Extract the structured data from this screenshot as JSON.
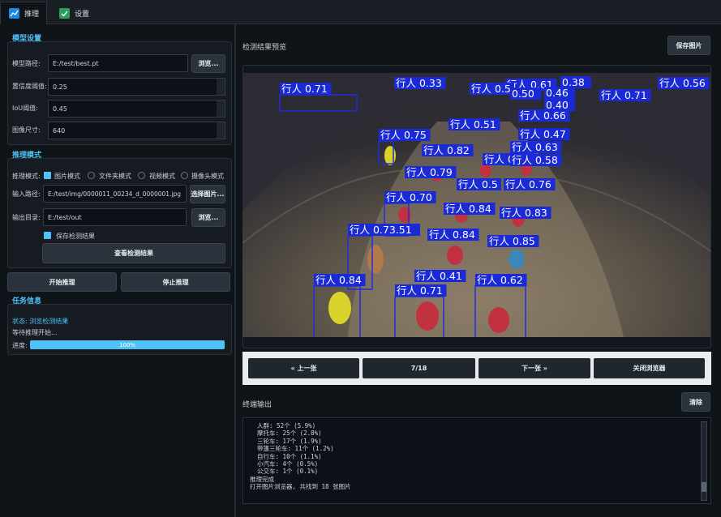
{
  "tabs": [
    {
      "label": "推理",
      "icon": "chart-icon",
      "active": true
    },
    {
      "label": "设置",
      "icon": "check-icon",
      "active": false
    }
  ],
  "model_settings": {
    "title": "模型设置",
    "model_path_label": "模型路径:",
    "model_path": "E:/test/best.pt",
    "browse_label": "浏览...",
    "conf_label": "置信度阈值:",
    "conf": "0.25",
    "iou_label": "IoU阈值:",
    "iou": "0.45",
    "size_label": "图像尺寸:",
    "size": "640"
  },
  "infer_mode": {
    "title": "推理模式",
    "mode_label": "推理模式:",
    "modes": [
      "图片模式",
      "文件夹模式",
      "视频模式",
      "摄像头模式"
    ],
    "selected": "图片模式",
    "input_label": "输入路径:",
    "input_path": "E:/test/img/0000011_00234_d_0000001.jpg",
    "select_image_label": "选择图片...",
    "output_label": "输出目录:",
    "output_path": "E:/test/out",
    "browse_label": "浏览...",
    "save_result_label": "保存检测结果",
    "view_result_label": "查看检测结果"
  },
  "actions": {
    "start": "开始推理",
    "stop": "停止推理"
  },
  "task_info": {
    "title": "任务信息",
    "status": "状态: 浏览检测结果",
    "waiting": "等待推理开始...",
    "progress_label": "进度:",
    "progress_text": "100%",
    "progress_fraction": 1.0
  },
  "preview": {
    "title": "检测结果预览",
    "save_label": "保存图片",
    "detections": [
      {
        "text": "行人 0.71"
      },
      {
        "text": "行人 0.33"
      },
      {
        "text": "行人 0.61"
      },
      {
        "text": "0.38"
      },
      {
        "text": "行人 0.56"
      },
      {
        "text": "行人 0.71"
      },
      {
        "text": "行人 0.5"
      },
      {
        "text": "0.46"
      },
      {
        "text": "0.50"
      },
      {
        "text": "0.40"
      },
      {
        "text": "行人 0.66"
      },
      {
        "text": "行人 0.51"
      },
      {
        "text": "行人 0.75"
      },
      {
        "text": "行人 0.47"
      },
      {
        "text": "行人 0.82"
      },
      {
        "text": "行人 0.63"
      },
      {
        "text": "行人 0.80"
      },
      {
        "text": "行人 0.58"
      },
      {
        "text": "行人 0.79"
      },
      {
        "text": "行人 0.5"
      },
      {
        "text": "行人 0.76"
      },
      {
        "text": "行人 0.70"
      },
      {
        "text": "行人 0.84"
      },
      {
        "text": "行人 0.83"
      },
      {
        "text": "行人 0.73.51"
      },
      {
        "text": "行人 0.84"
      },
      {
        "text": "行人 0.85"
      },
      {
        "text": "行人 0.84"
      },
      {
        "text": "行人 0.41"
      },
      {
        "text": "行人 0.71"
      },
      {
        "text": "行人 0.62"
      }
    ]
  },
  "nav": {
    "prev": "« 上一张",
    "counter": "7/18",
    "next": "下一张 »",
    "close": "关闭浏览器"
  },
  "terminal": {
    "title": "终端输出",
    "clear_label": "清除",
    "lines": [
      "  人群: 52个 (5.9%)",
      "  摩托车: 25个 (2.8%)",
      "  三轮车: 17个 (1.9%)",
      "  带篷三轮车: 11个 (1.2%)",
      "  自行车: 10个 (1.1%)",
      "  小汽车: 4个 (0.5%)",
      "  公交车: 1个 (0.1%)",
      "推理完成",
      "打开图片浏览器, 共找到 18 张图片"
    ]
  },
  "colors": {
    "accent": "#4fc3f7",
    "box": "#1f2fd8",
    "label_bg": "#1a2ad6"
  }
}
